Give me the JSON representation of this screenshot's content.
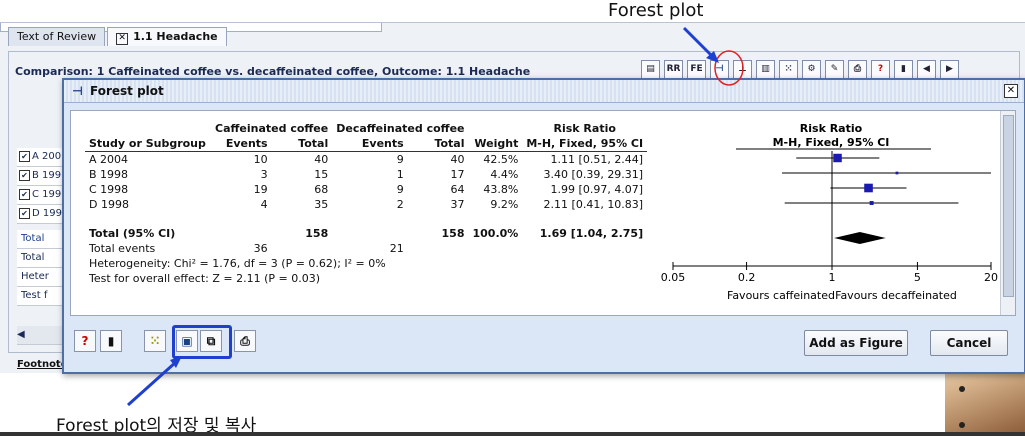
{
  "annotations": {
    "top_label": "Forest plot",
    "bottom_label": "Forest plot의 저장 및 복사"
  },
  "app": {
    "tabs": [
      {
        "label": "Text of Review"
      },
      {
        "label": "1.1 Headache"
      }
    ],
    "comparison": "Comparison: 1 Caffeinated coffee vs. decaffeinated coffee, Outcome: 1.1 Headache",
    "toolbar": [
      "RR",
      "FE"
    ],
    "left_rows": [
      "A 200",
      "B 199",
      "C 199",
      "D 199",
      "Total",
      "Total",
      "Heter",
      "Test f"
    ],
    "footnote": "Footnote:"
  },
  "dialog": {
    "title": "Forest plot",
    "add_button": "Add as Figure",
    "cancel_button": "Cancel"
  },
  "table": {
    "group1": "Caffeinated coffee",
    "group2": "Decaffeinated coffee",
    "risk_ratio": "Risk Ratio",
    "risk_ratio_plot": "Risk Ratio",
    "columns": [
      "Study or Subgroup",
      "Events",
      "Total",
      "Events",
      "Total",
      "Weight",
      "M-H, Fixed, 95% CI",
      "M-H, Fixed, 95% CI"
    ],
    "rows": [
      {
        "study": "A 2004",
        "e1": "10",
        "t1": "40",
        "e2": "9",
        "t2": "40",
        "weight": "42.5%",
        "ci": "1.11 [0.51, 2.44]"
      },
      {
        "study": "B 1998",
        "e1": "3",
        "t1": "15",
        "e2": "1",
        "t2": "17",
        "weight": "4.4%",
        "ci": "3.40 [0.39, 29.31]"
      },
      {
        "study": "C 1998",
        "e1": "19",
        "t1": "68",
        "e2": "9",
        "t2": "64",
        "weight": "43.8%",
        "ci": "1.99 [0.97, 4.07]"
      },
      {
        "study": "D 1998",
        "e1": "4",
        "t1": "35",
        "e2": "2",
        "t2": "37",
        "weight": "9.2%",
        "ci": "2.11 [0.41, 10.83]"
      }
    ],
    "total": {
      "label": "Total (95% CI)",
      "t1": "158",
      "t2": "158",
      "weight": "100.0%",
      "ci": "1.69 [1.04, 2.75]"
    },
    "events": {
      "label": "Total events",
      "e1": "36",
      "e2": "21"
    },
    "heterogeneity": "Heterogeneity: Chi² = 1.76, df = 3 (P = 0.62); I² = 0%",
    "overall": "Test for overall effect: Z = 2.11 (P = 0.03)"
  },
  "chart_data": {
    "type": "scatter",
    "scale": "log",
    "ticks": [
      0.05,
      0.2,
      1,
      5,
      20
    ],
    "tick_labels": [
      "0.05",
      "0.2",
      "1",
      "5",
      "20"
    ],
    "xlabel_left": "Favours caffeinated",
    "xlabel_right": "Favours decaffeinated",
    "studies": [
      {
        "rr": 1.11,
        "lo": 0.51,
        "hi": 2.44,
        "weight": 42.5
      },
      {
        "rr": 3.4,
        "lo": 0.39,
        "hi": 29.31,
        "weight": 4.4
      },
      {
        "rr": 1.99,
        "lo": 0.97,
        "hi": 4.07,
        "weight": 43.8
      },
      {
        "rr": 2.11,
        "lo": 0.41,
        "hi": 10.83,
        "weight": 9.2
      }
    ],
    "pooled": {
      "rr": 1.69,
      "lo": 1.04,
      "hi": 2.75
    },
    "colors": {
      "marker": "#1a1ab0",
      "line": "#000000",
      "diamond": "#000000"
    }
  }
}
